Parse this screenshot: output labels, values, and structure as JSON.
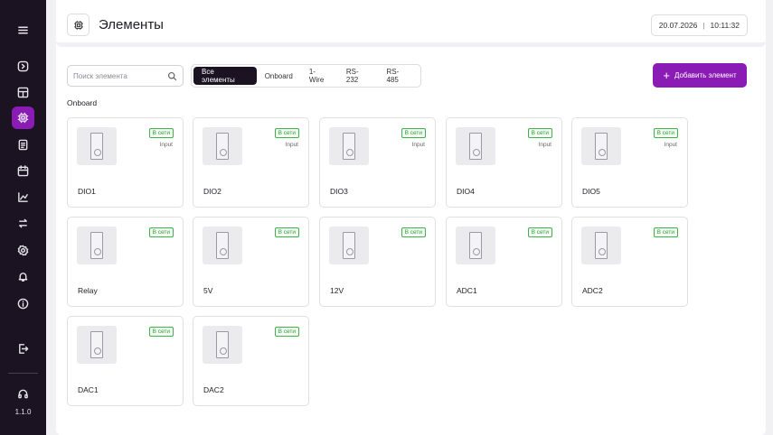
{
  "header": {
    "title": "Элементы",
    "date": "20.07.2026",
    "separator": "|",
    "time": "10:11:32"
  },
  "search": {
    "placeholder": "Поиск элемента"
  },
  "filters": [
    "Все элементы",
    "Onboard",
    "1-Wire",
    "RS-232",
    "RS-485"
  ],
  "add_button": {
    "plus": "+",
    "label": "Добавить элемент"
  },
  "section": "Onboard",
  "status_online": "В сети",
  "cards": [
    {
      "name": "DIO1",
      "mode": "Input"
    },
    {
      "name": "DIO2",
      "mode": "Input"
    },
    {
      "name": "DIO3",
      "mode": "Input"
    },
    {
      "name": "DIO4",
      "mode": "Input"
    },
    {
      "name": "DIO5",
      "mode": "Input"
    },
    {
      "name": "Relay",
      "mode": ""
    },
    {
      "name": "5V",
      "mode": ""
    },
    {
      "name": "12V",
      "mode": ""
    },
    {
      "name": "ADC1",
      "mode": ""
    },
    {
      "name": "ADC2",
      "mode": ""
    },
    {
      "name": "DAC1",
      "mode": ""
    },
    {
      "name": "DAC2",
      "mode": ""
    }
  ],
  "sidebar": {
    "icons": [
      "menu-icon",
      "play-circle-icon",
      "dashboard-icon",
      "elements-icon",
      "document-icon",
      "calendar-icon",
      "chart-icon",
      "sync-icon",
      "settings-icon",
      "bell-icon",
      "info-icon",
      "logout-icon",
      "headset-icon"
    ],
    "version": "1.1.0"
  },
  "colors": {
    "accent": "#8a1bb4",
    "sidebar": "#1b1222",
    "online": "#3db34a"
  }
}
